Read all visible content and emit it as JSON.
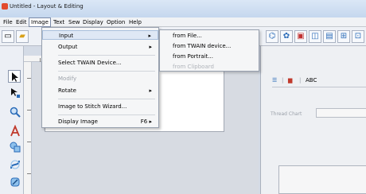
{
  "window": {
    "title": "Untitled - Layout & Editing"
  },
  "menubar": [
    {
      "label": "File",
      "id": "file"
    },
    {
      "label": "Edit",
      "id": "edit"
    },
    {
      "label": "Image",
      "id": "image"
    },
    {
      "label": "Text",
      "id": "text"
    },
    {
      "label": "Sew",
      "id": "sew"
    },
    {
      "label": "Display",
      "id": "display"
    },
    {
      "label": "Option",
      "id": "option"
    },
    {
      "label": "Help",
      "id": "help"
    }
  ],
  "image_menu": {
    "items": [
      {
        "label": "Input",
        "arrow": "▸"
      },
      {
        "label": "Output",
        "arrow": "▸"
      },
      {
        "label": "Select TWAIN Device..."
      },
      {
        "label": "Modify"
      },
      {
        "label": "Rotate",
        "arrow": "▸"
      },
      {
        "label": "Image to Stitch Wizard..."
      },
      {
        "label": "Display Image",
        "shortcut": "F6 ▸"
      }
    ]
  },
  "input_submenu": {
    "items": [
      {
        "label": "from File..."
      },
      {
        "label": "from TWAIN device..."
      },
      {
        "label": "from Portrait..."
      },
      {
        "label": "from Clipboard"
      }
    ]
  },
  "right_panel": {
    "tab_abc": "ABC",
    "field_label": "Thread Chart"
  },
  "colors": {
    "accent": "#dfe8f5",
    "page": "#ffffff",
    "disabled": "#9ea3ab"
  }
}
